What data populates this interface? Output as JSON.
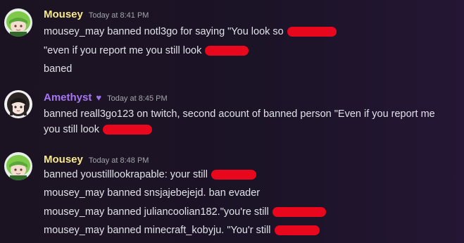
{
  "messages": [
    {
      "author": "Mousey",
      "timestamp": "Today at 8:41 PM",
      "lines": [
        "mousey_may banned notl3go for saying \"You look so",
        "\"even if you report me you still look",
        "baned"
      ]
    },
    {
      "author": "Amethyst",
      "role_icon": "♥",
      "timestamp": "Today at 8:45 PM",
      "lines": [
        "banned reall3go123 on twitch, second acount of banned person  \"Even if you report me",
        "you still look"
      ]
    },
    {
      "author": "Mousey",
      "timestamp": "Today at 8:48 PM",
      "lines": [
        "banned youstilllookrapable: your still",
        "mousey_may banned snsjajebejejd. ban evader",
        "mousey_may banned juliancoolian182.\"you're still",
        "mousey_may banned minecraft_kobyju. \"You'r still"
      ]
    }
  ],
  "colors": {
    "mousey_name": "#f7e98e",
    "amethyst_name": "#a677f2",
    "redaction": "#e8071c",
    "background": "#1c1322"
  },
  "icons": {
    "mousey_avatar": "green-hair-anime-avatar",
    "amethyst_avatar": "dark-hair-anime-avatar",
    "role_icon": "purple-heart-icon"
  }
}
